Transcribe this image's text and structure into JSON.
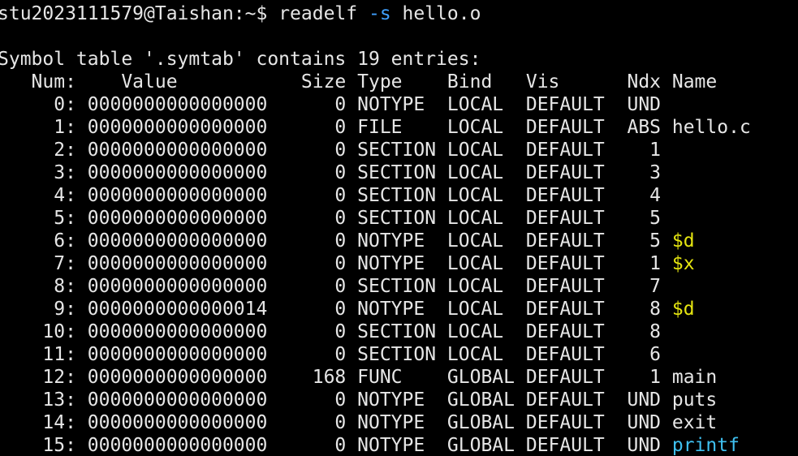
{
  "terminal": {
    "previous_line_fragment": "  ~  ~  ~  ~  ~  ~  ~  ~  ~  ~  ~  ~  ~",
    "prompt": "stu2023111579@Taishan:~$ ",
    "command": "readelf ",
    "command_flag": "-s",
    "command_arg": " hello.o",
    "symtab_header": "Symbol table '.symtab' contains 19 entries:",
    "columns": [
      "Num:",
      "Value",
      "Size",
      "Type",
      "Bind",
      "Vis",
      "Ndx",
      "Name"
    ],
    "entries": [
      {
        "num": "0:",
        "value": "0000000000000000",
        "size": "0",
        "type": "NOTYPE",
        "bind": "LOCAL",
        "vis": "DEFAULT",
        "ndx": "UND",
        "name": "",
        "name_color": ""
      },
      {
        "num": "1:",
        "value": "0000000000000000",
        "size": "0",
        "type": "FILE",
        "bind": "LOCAL",
        "vis": "DEFAULT",
        "ndx": "ABS",
        "name": "hello.c",
        "name_color": ""
      },
      {
        "num": "2:",
        "value": "0000000000000000",
        "size": "0",
        "type": "SECTION",
        "bind": "LOCAL",
        "vis": "DEFAULT",
        "ndx": "1",
        "name": "",
        "name_color": ""
      },
      {
        "num": "3:",
        "value": "0000000000000000",
        "size": "0",
        "type": "SECTION",
        "bind": "LOCAL",
        "vis": "DEFAULT",
        "ndx": "3",
        "name": "",
        "name_color": ""
      },
      {
        "num": "4:",
        "value": "0000000000000000",
        "size": "0",
        "type": "SECTION",
        "bind": "LOCAL",
        "vis": "DEFAULT",
        "ndx": "4",
        "name": "",
        "name_color": ""
      },
      {
        "num": "5:",
        "value": "0000000000000000",
        "size": "0",
        "type": "SECTION",
        "bind": "LOCAL",
        "vis": "DEFAULT",
        "ndx": "5",
        "name": "",
        "name_color": ""
      },
      {
        "num": "6:",
        "value": "0000000000000000",
        "size": "0",
        "type": "NOTYPE",
        "bind": "LOCAL",
        "vis": "DEFAULT",
        "ndx": "5",
        "name": "$d",
        "name_color": "yellow"
      },
      {
        "num": "7:",
        "value": "0000000000000000",
        "size": "0",
        "type": "NOTYPE",
        "bind": "LOCAL",
        "vis": "DEFAULT",
        "ndx": "1",
        "name": "$x",
        "name_color": "yellow"
      },
      {
        "num": "8:",
        "value": "0000000000000000",
        "size": "0",
        "type": "SECTION",
        "bind": "LOCAL",
        "vis": "DEFAULT",
        "ndx": "7",
        "name": "",
        "name_color": ""
      },
      {
        "num": "9:",
        "value": "0000000000000014",
        "size": "0",
        "type": "NOTYPE",
        "bind": "LOCAL",
        "vis": "DEFAULT",
        "ndx": "8",
        "name": "$d",
        "name_color": "yellow"
      },
      {
        "num": "10:",
        "value": "0000000000000000",
        "size": "0",
        "type": "SECTION",
        "bind": "LOCAL",
        "vis": "DEFAULT",
        "ndx": "8",
        "name": "",
        "name_color": ""
      },
      {
        "num": "11:",
        "value": "0000000000000000",
        "size": "0",
        "type": "SECTION",
        "bind": "LOCAL",
        "vis": "DEFAULT",
        "ndx": "6",
        "name": "",
        "name_color": ""
      },
      {
        "num": "12:",
        "value": "0000000000000000",
        "size": "168",
        "type": "FUNC",
        "bind": "GLOBAL",
        "vis": "DEFAULT",
        "ndx": "1",
        "name": "main",
        "name_color": ""
      },
      {
        "num": "13:",
        "value": "0000000000000000",
        "size": "0",
        "type": "NOTYPE",
        "bind": "GLOBAL",
        "vis": "DEFAULT",
        "ndx": "UND",
        "name": "puts",
        "name_color": ""
      },
      {
        "num": "14:",
        "value": "0000000000000000",
        "size": "0",
        "type": "NOTYPE",
        "bind": "GLOBAL",
        "vis": "DEFAULT",
        "ndx": "UND",
        "name": "exit",
        "name_color": ""
      },
      {
        "num": "15:",
        "value": "0000000000000000",
        "size": "0",
        "type": "NOTYPE",
        "bind": "GLOBAL",
        "vis": "DEFAULT",
        "ndx": "UND",
        "name": "printf",
        "name_color": "blue"
      }
    ]
  },
  "colors": {
    "background": "#000000",
    "foreground": "#e6e6e6",
    "flag": "#3fa0ff",
    "highlight_yellow": "#e5e510",
    "highlight_blue": "#3fc0f0"
  }
}
